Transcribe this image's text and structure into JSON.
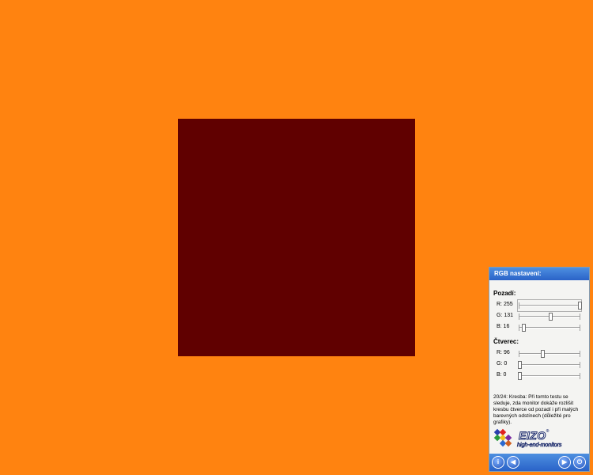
{
  "colors": {
    "background": "#FF8310",
    "square": "#600000"
  },
  "panel": {
    "title": "RGB nastavení:",
    "background_section": {
      "heading": "Pozadí:",
      "sliders": [
        {
          "label": "R: 255",
          "value": 255,
          "max": 255,
          "focused": true
        },
        {
          "label": "G: 131",
          "value": 131,
          "max": 255,
          "focused": false
        },
        {
          "label": "B: 16",
          "value": 16,
          "max": 255,
          "focused": false
        }
      ]
    },
    "square_section": {
      "heading": "Čtverec:",
      "sliders": [
        {
          "label": "R: 96",
          "value": 96,
          "max": 255,
          "focused": false
        },
        {
          "label": "G: 0",
          "value": 0,
          "max": 255,
          "focused": false
        },
        {
          "label": "B: 0",
          "value": 0,
          "max": 255,
          "focused": false
        }
      ]
    },
    "description": "20/24: Kresba: Při tomto testu se sleduje, zda monitor dokáže rozlišit kresbu čtverce od pozadí i při malých barevných odstínech (důležité pro grafiky).",
    "logo": {
      "brand": "EIZO",
      "registered": "®",
      "tagline": "high-end-monitors"
    },
    "nav": {
      "info": "i",
      "prev": "◀",
      "next": "▶",
      "power": "⏻"
    }
  }
}
